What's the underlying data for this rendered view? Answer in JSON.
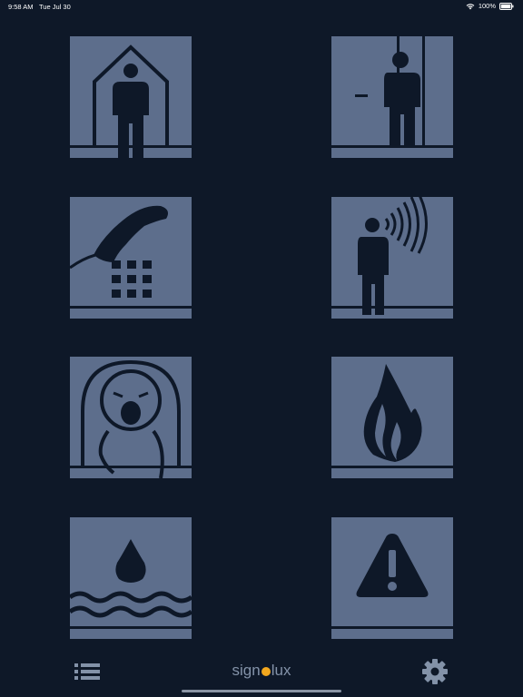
{
  "status_bar": {
    "time": "9:58 AM",
    "date": "Tue Jul 30",
    "battery": "100%",
    "icons": [
      "wifi-icon",
      "battery-icon"
    ]
  },
  "tiles": [
    {
      "name": "shelter-icon",
      "meaning": "shelter"
    },
    {
      "name": "door-visitor-icon",
      "meaning": "door"
    },
    {
      "name": "telephone-icon",
      "meaning": "telephone"
    },
    {
      "name": "calling-person-icon",
      "meaning": "calling person"
    },
    {
      "name": "crying-baby-icon",
      "meaning": "baby crying"
    },
    {
      "name": "fire-icon",
      "meaning": "fire"
    },
    {
      "name": "water-flood-icon",
      "meaning": "water"
    },
    {
      "name": "warning-icon",
      "meaning": "warning"
    }
  ],
  "bottom_bar": {
    "logo_left": "sign",
    "logo_right": "lux",
    "icons": [
      "list-menu-icon",
      "gear-icon"
    ]
  },
  "colors": {
    "background": "#0e1828",
    "tile": "#5d6e8c",
    "glyph": "#0e1828",
    "accent": "#f3a81e"
  }
}
